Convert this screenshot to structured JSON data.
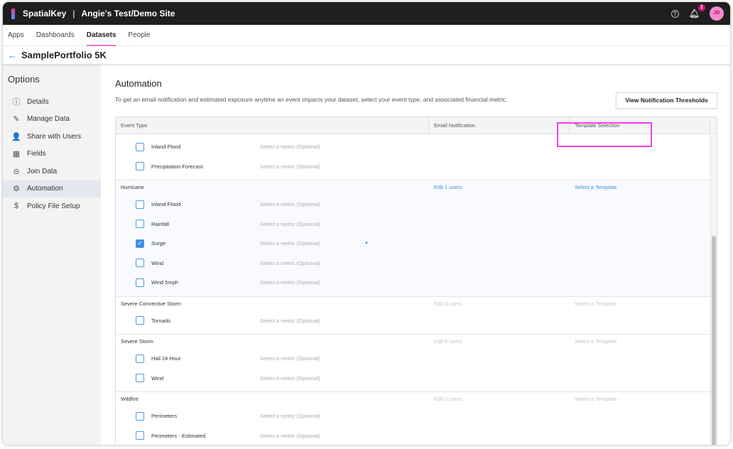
{
  "app": {
    "brand": "SpatialKey",
    "site": "Angie's Test/Demo Site",
    "notif_count": "1",
    "avatar": "JD",
    "help": "?"
  },
  "nav": [
    "Apps",
    "Dashboards",
    "Datasets",
    "People"
  ],
  "page_title": "SamplePortfolio 5K",
  "sidebar": {
    "title": "Options",
    "items": [
      {
        "label": "Details",
        "icon": "ⓘ"
      },
      {
        "label": "Manage Data",
        "icon": "✎"
      },
      {
        "label": "Share with Users",
        "icon": "👤"
      },
      {
        "label": "Fields",
        "icon": "▦"
      },
      {
        "label": "Join Data",
        "icon": "⊝"
      },
      {
        "label": "Automation",
        "icon": "⚙"
      },
      {
        "label": "Policy File Setup",
        "icon": "$"
      }
    ]
  },
  "main": {
    "title": "Automation",
    "description": "To get an email notification and estimated exposure anytime an event impacts your dataset, select your event type, and associated financial metric.",
    "view_button": "View Notification Thresholds",
    "columns": [
      "Event Type",
      "Email Notification",
      "Template Selection"
    ],
    "metric_placeholder": "Select a metric (Optional)",
    "groups": [
      {
        "name": "",
        "active": false,
        "email": "",
        "template": "",
        "items": [
          {
            "label": "Inland Flood",
            "checked": false
          },
          {
            "label": "Precipitation Forecast",
            "checked": false
          }
        ]
      },
      {
        "name": "Hurricane",
        "active": true,
        "email": "Edit 1 users",
        "template": "Select a Template",
        "items": [
          {
            "label": "Inland Flood",
            "checked": false
          },
          {
            "label": "Rainfall",
            "checked": false
          },
          {
            "label": "Surge",
            "checked": true
          },
          {
            "label": "Wind",
            "checked": false
          },
          {
            "label": "Wind 5mph",
            "checked": false
          }
        ]
      },
      {
        "name": "Severe Convective Storm",
        "active": false,
        "email": "Edit 0 users",
        "template": "Select a Template",
        "items": [
          {
            "label": "Tornado",
            "checked": false
          }
        ]
      },
      {
        "name": "Severe Storm",
        "active": false,
        "email": "Edit 0 users",
        "template": "Select a Template",
        "items": [
          {
            "label": "Hail 24 Hour",
            "checked": false
          },
          {
            "label": "Wind",
            "checked": false
          }
        ]
      },
      {
        "name": "Wildfire",
        "active": false,
        "email": "Edit 0 users",
        "template": "Select a Template",
        "items": [
          {
            "label": "Perimeters",
            "checked": false
          },
          {
            "label": "Perimeters - Estimated",
            "checked": false
          }
        ]
      }
    ]
  }
}
